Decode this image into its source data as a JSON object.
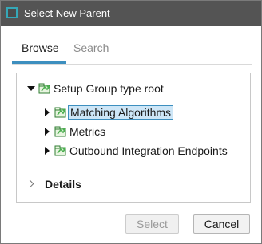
{
  "window": {
    "title": "Select New Parent",
    "icon": "window-icon"
  },
  "tabs": [
    {
      "label": "Browse",
      "active": true
    },
    {
      "label": "Search",
      "active": false
    }
  ],
  "tree": {
    "root": {
      "label": "Setup Group type root",
      "expanded": true,
      "icon": "setup-group-icon"
    },
    "children": [
      {
        "label": "Matching Algorithms",
        "expanded": false,
        "selected": true,
        "icon": "setup-group-icon"
      },
      {
        "label": "Metrics",
        "expanded": false,
        "selected": false,
        "icon": "setup-group-icon"
      },
      {
        "label": "Outbound Integration Endpoints",
        "expanded": false,
        "selected": false,
        "icon": "setup-group-icon"
      }
    ]
  },
  "details": {
    "label": "Details",
    "expanded": false
  },
  "buttons": {
    "select": {
      "label": "Select",
      "enabled": false
    },
    "cancel": {
      "label": "Cancel",
      "enabled": true
    }
  },
  "colors": {
    "titlebar": "#545454",
    "accent": "#3d8fbf",
    "selection_fill": "#cde6f7",
    "icon_green": "#4caf50"
  }
}
